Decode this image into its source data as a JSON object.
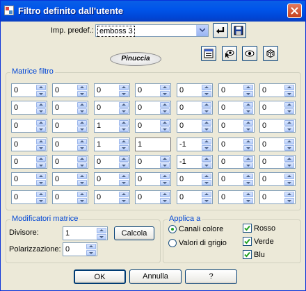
{
  "window": {
    "title": "Filtro definito dall'utente",
    "icon": "app-icon",
    "close_icon": "close-icon"
  },
  "preset": {
    "label": "Imp. predef.:",
    "value": "emboss 3"
  },
  "toolbar": {
    "load_icon": "undo-arrow-icon",
    "save_icon": "floppy-disk-icon",
    "icons": [
      "preview-window-icon",
      "eye-pointer-icon",
      "eye-icon",
      "dice-icon"
    ]
  },
  "logo": {
    "text": "Pinuccia"
  },
  "matrix": {
    "title": "Matrice filtro",
    "rows": [
      [
        "0",
        "0",
        "0",
        "0",
        "0",
        "0",
        "0"
      ],
      [
        "0",
        "0",
        "0",
        "0",
        "0",
        "0",
        "0"
      ],
      [
        "0",
        "0",
        "1",
        "0",
        "0",
        "0",
        "0"
      ],
      [
        "0",
        "0",
        "1",
        "1",
        "-1",
        "0",
        "0"
      ],
      [
        "0",
        "0",
        "0",
        "0",
        "-1",
        "0",
        "0"
      ],
      [
        "0",
        "0",
        "0",
        "0",
        "0",
        "0",
        "0"
      ],
      [
        "0",
        "0",
        "0",
        "0",
        "0",
        "0",
        "0"
      ]
    ]
  },
  "modifiers": {
    "title": "Modificatori matrice",
    "divisor_label": "Divisore:",
    "divisor_value": "1",
    "bias_label": "Polarizzazione:",
    "bias_value": "0",
    "calc_label": "Calcola"
  },
  "apply": {
    "title": "Applica a",
    "color_label": "Canali colore",
    "gray_label": "Valori di grigio",
    "selected": "Canali colore",
    "red_label": "Rosso",
    "green_label": "Verde",
    "blue_label": "Blu",
    "red_checked": true,
    "green_checked": true,
    "blue_checked": true
  },
  "buttons": {
    "ok": "OK",
    "cancel": "Annulla",
    "help": "?"
  }
}
